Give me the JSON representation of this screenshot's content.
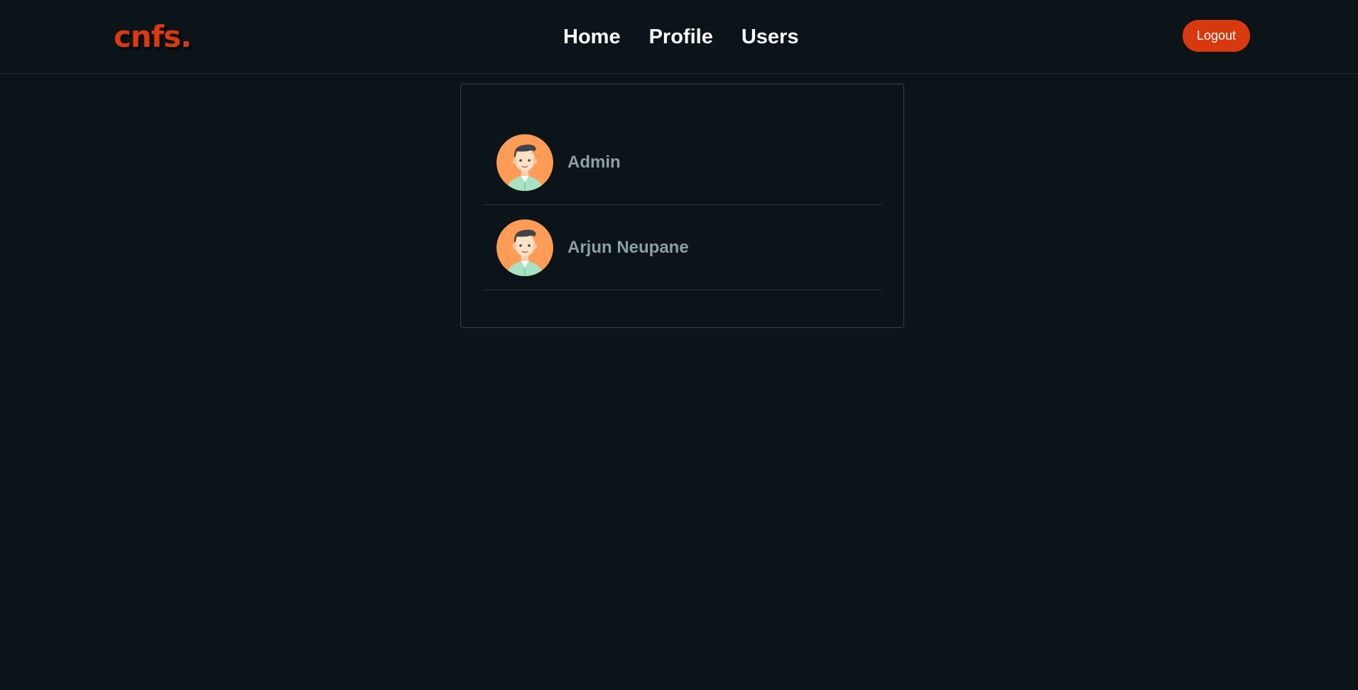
{
  "brand": {
    "logo_text": "cnfs.",
    "accent_color": "#d8390e"
  },
  "nav": {
    "links": [
      {
        "label": "Home"
      },
      {
        "label": "Profile"
      },
      {
        "label": "Users"
      }
    ],
    "logout_label": "Logout"
  },
  "users": [
    {
      "name": "Admin",
      "avatar_icon": "male-user-avatar-icon"
    },
    {
      "name": "Arjun Neupane",
      "avatar_icon": "male-user-avatar-icon"
    }
  ],
  "colors": {
    "background": "#0b1418",
    "avatar_bg": "#fe9c57",
    "user_name": "#8e9fa3"
  }
}
